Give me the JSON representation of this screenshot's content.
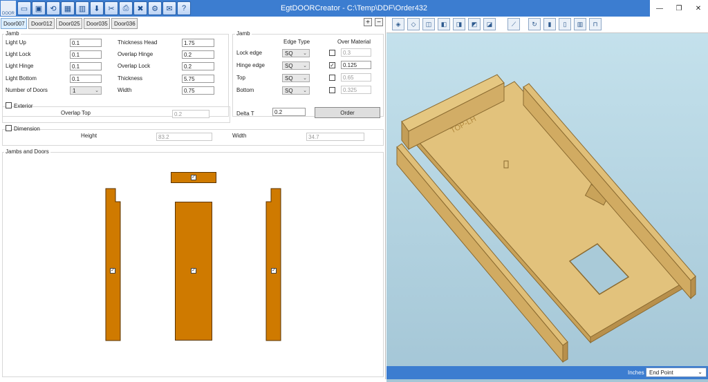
{
  "window": {
    "title": "EgtDOORCreator - C:\\Temp\\DDF\\Order432",
    "app_icon_text": "DOOR"
  },
  "toolbar": {
    "buttons": [
      {
        "name": "new-icon",
        "glyph": "▭"
      },
      {
        "name": "open-icon",
        "glyph": "▣"
      },
      {
        "name": "refresh-icon",
        "glyph": "⟲"
      },
      {
        "name": "save-icon",
        "glyph": "▦"
      },
      {
        "name": "save-as-icon",
        "glyph": "▥"
      },
      {
        "name": "export-icon",
        "glyph": "⬇"
      },
      {
        "name": "cutter-icon",
        "glyph": "✂"
      },
      {
        "name": "print-icon",
        "glyph": "⎙"
      },
      {
        "name": "tools-icon",
        "glyph": "✖"
      },
      {
        "name": "settings-icon",
        "glyph": "⚙"
      },
      {
        "name": "mail-icon",
        "glyph": "✉"
      },
      {
        "name": "help-icon",
        "glyph": "?"
      }
    ]
  },
  "tabs": [
    "Door007",
    "Door012",
    "Door025",
    "Door035",
    "Door036"
  ],
  "tab_tools": {
    "add": "+",
    "remove": "−"
  },
  "jamb_left": {
    "title": "Jamb",
    "fields": [
      {
        "label": "Light Up",
        "value": "0.1"
      },
      {
        "label": "Light Lock",
        "value": "0.1"
      },
      {
        "label": "Light Hinge",
        "value": "0.1"
      },
      {
        "label": "Light Bottom",
        "value": "0.1"
      },
      {
        "label": "Number of Doors",
        "value": "1"
      }
    ],
    "fields2": [
      {
        "label": "Thickness Head",
        "value": "1.75"
      },
      {
        "label": "Overlap Hinge",
        "value": "0.2"
      },
      {
        "label": "Overlap Lock",
        "value": "0.2"
      },
      {
        "label": "Thickness",
        "value": "5.75"
      },
      {
        "label": "Width",
        "value": "0.75"
      }
    ]
  },
  "jamb_right": {
    "title": "Jamb",
    "col_edge": "Edge Type",
    "col_over": "Over Material",
    "rows": [
      {
        "label": "Lock edge",
        "edge": "SQ",
        "checked": false,
        "value": "0.3"
      },
      {
        "label": "Hinge edge",
        "edge": "SQ",
        "checked": true,
        "value": "0.125"
      },
      {
        "label": "Top",
        "edge": "SQ",
        "checked": false,
        "value": "0.65"
      },
      {
        "label": "Bottom",
        "edge": "SQ",
        "checked": false,
        "value": "0.325"
      }
    ]
  },
  "exterior": {
    "label": "Exterior",
    "overlap_label": "Overlap Top",
    "overlap_value": "0.2"
  },
  "delta": {
    "label": "Delta T",
    "value": "0.2",
    "order_button": "Order"
  },
  "dimension": {
    "label": "Dimension",
    "height_label": "Height",
    "height_value": "83.2",
    "width_label": "Width",
    "width_value": "34.7"
  },
  "jambs_doors": {
    "title": "Jambs and Doors"
  },
  "viewport": {
    "door_label": "TOP-LH"
  },
  "status": {
    "units_label": "Inches",
    "snap_value": "End Point"
  },
  "colors": {
    "titlebar": "#3c7dd0",
    "piece": "#cf7a00",
    "wood": "#e2c27c"
  }
}
